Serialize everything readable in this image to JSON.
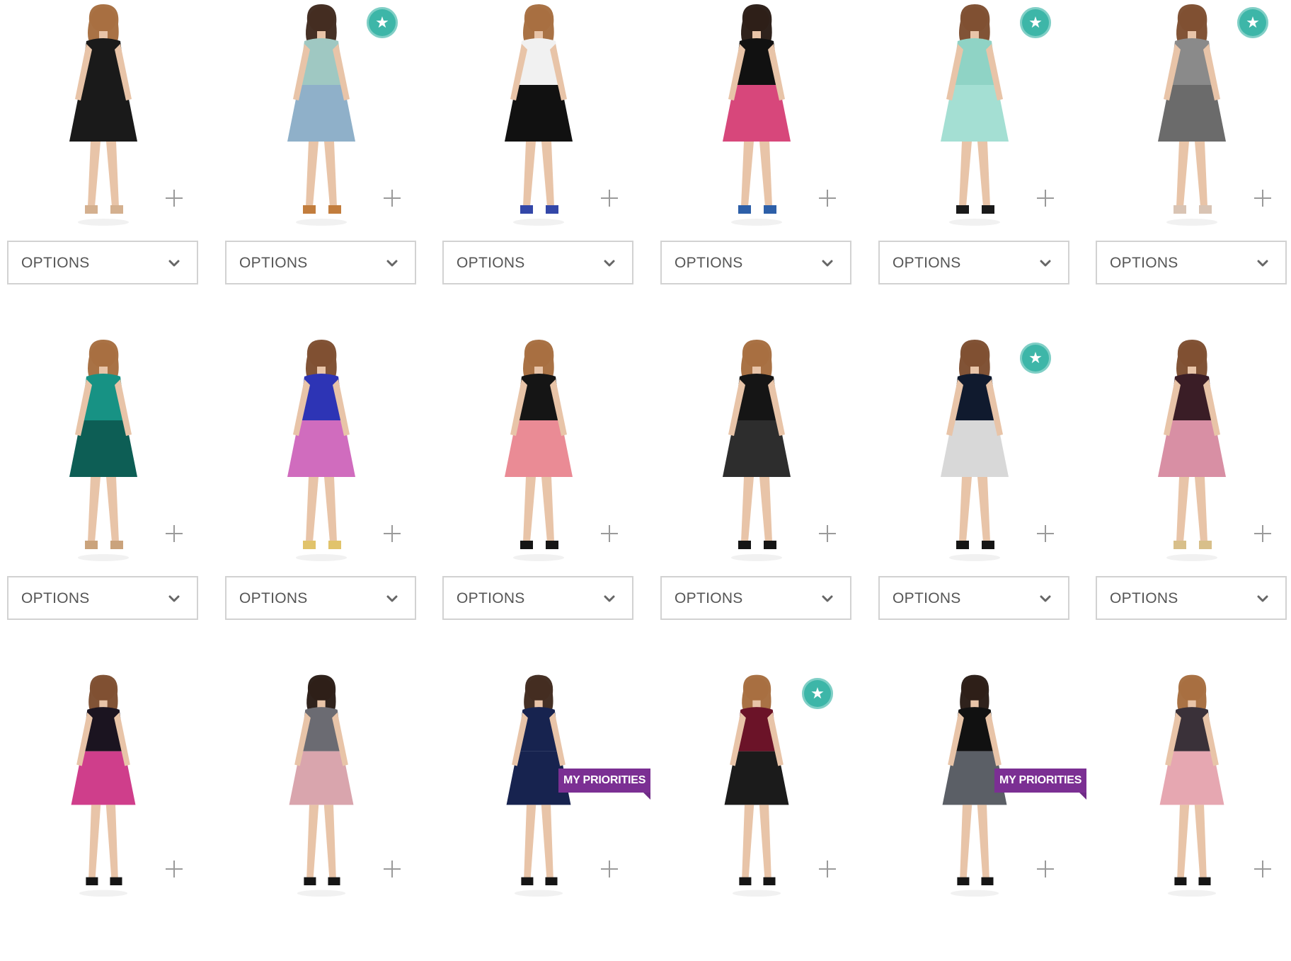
{
  "colors": {
    "badge": "#3db6a8",
    "priority_tag": "#7b2f93",
    "border": "#d2d2d2",
    "text": "#555555",
    "plus": "#9a9a9a"
  },
  "options_label": "OPTIONS",
  "grid": {
    "rows": [
      {
        "products": [
          {
            "outfit": "black jumpsuit",
            "badge": false,
            "priority": false
          },
          {
            "outfit": "printed tunic with jeans",
            "badge": true,
            "priority": false
          },
          {
            "outfit": "white tee and black shorts",
            "badge": false,
            "priority": false
          },
          {
            "outfit": "black top and printed skirt",
            "badge": false,
            "priority": false
          },
          {
            "outfit": "mint floral dress",
            "badge": true,
            "priority": false
          },
          {
            "outfit": "grey belted dress",
            "badge": true,
            "priority": false
          }
        ]
      },
      {
        "products": [
          {
            "outfit": "teal printed dress",
            "badge": false,
            "priority": false
          },
          {
            "outfit": "blue watercolor dress",
            "badge": false,
            "priority": false
          },
          {
            "outfit": "black floral dress",
            "badge": false,
            "priority": false
          },
          {
            "outfit": "black star print dress",
            "badge": false,
            "priority": false
          },
          {
            "outfit": "black feather print dress",
            "badge": true,
            "priority": false
          },
          {
            "outfit": "geometric print dress",
            "badge": false,
            "priority": false
          }
        ]
      },
      {
        "products": [
          {
            "outfit": "pink floral dress",
            "badge": false,
            "priority": false
          },
          {
            "outfit": "grey pink printed dress",
            "badge": false,
            "priority": false
          },
          {
            "outfit": "navy fit and flare dress",
            "badge": false,
            "priority": true,
            "priority_label": "MY PRIORITIES"
          },
          {
            "outfit": "burgundy printed dress",
            "badge": true,
            "priority": false
          },
          {
            "outfit": "black top and pleated skirt",
            "badge": false,
            "priority": true,
            "priority_label": "MY PRIORITIES"
          },
          {
            "outfit": "blush floral dress",
            "badge": false,
            "priority": false
          }
        ]
      }
    ]
  }
}
